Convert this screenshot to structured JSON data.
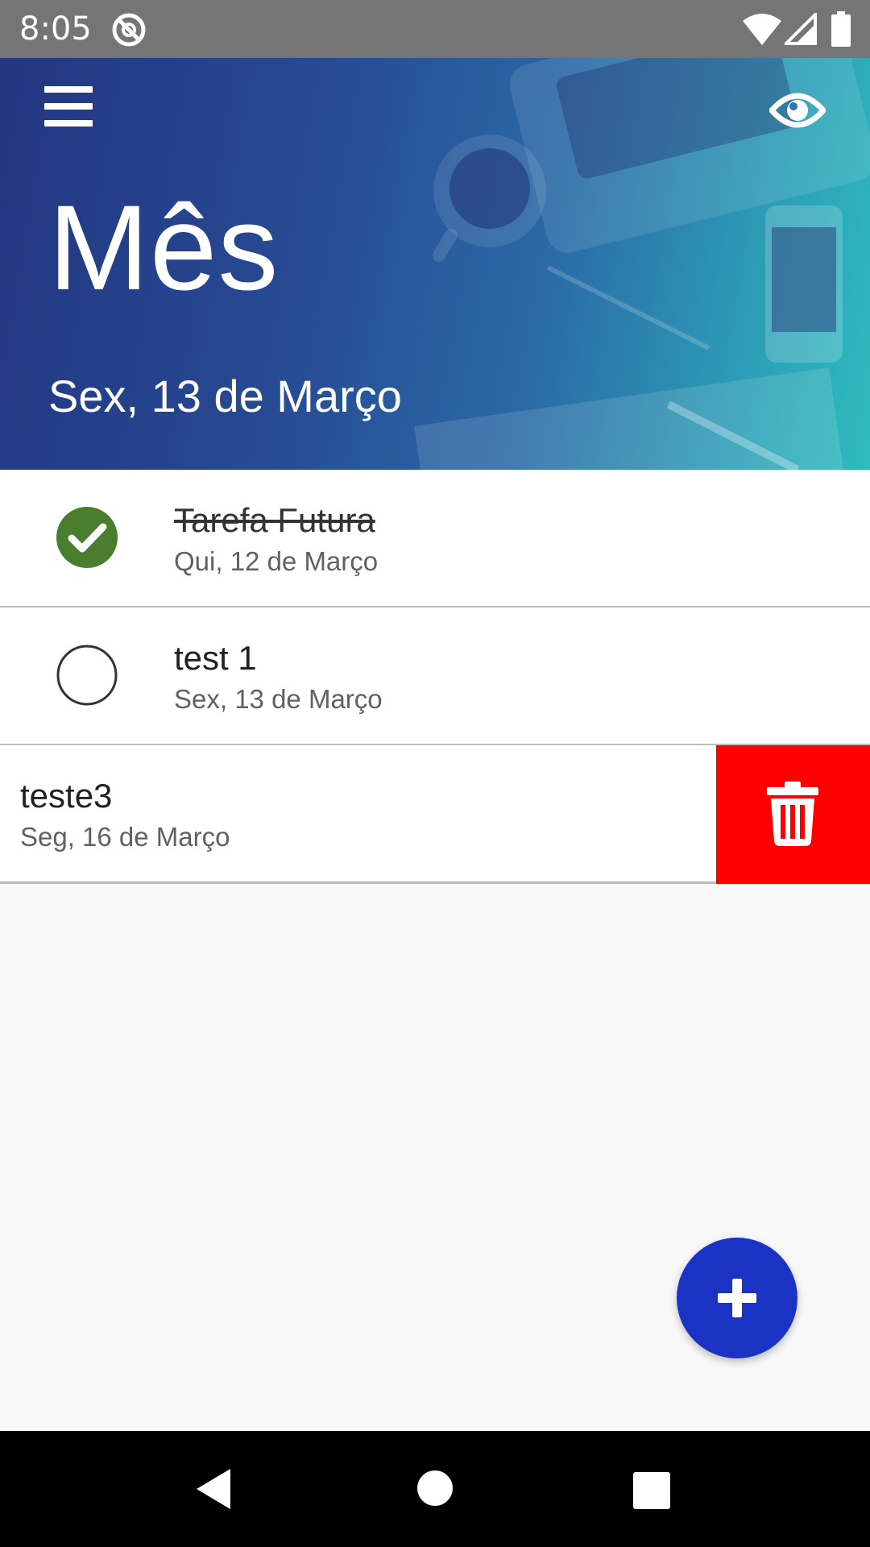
{
  "status_bar": {
    "time": "8:05",
    "icons": [
      "at-sign-icon",
      "wifi-icon",
      "signal-icon",
      "battery-icon"
    ]
  },
  "header": {
    "title": "Mês",
    "date": "Sex, 13 de Março",
    "menu_icon": "hamburger-menu-icon",
    "action_icon": "eye-icon",
    "gradient_colors": [
      "#233682",
      "#2fbcbf"
    ]
  },
  "tasks": [
    {
      "title": "Tarefa Futura",
      "date": "Qui, 12 de Março",
      "completed": true
    },
    {
      "title": "test 1",
      "date": "Sex, 13 de Março",
      "completed": false
    },
    {
      "title": "teste3",
      "date": "Seg, 16 de Março",
      "completed": false,
      "swiped": true
    }
  ],
  "swipe_action": {
    "icon": "trash-icon",
    "color": "#ff0000"
  },
  "fab": {
    "icon": "plus-icon",
    "color": "#1a33c4"
  },
  "colors": {
    "check_done": "#4a7d2e",
    "background": "#f8f8f8"
  },
  "nav_bar": {
    "icons": [
      "back-icon",
      "home-icon",
      "recents-icon"
    ]
  }
}
